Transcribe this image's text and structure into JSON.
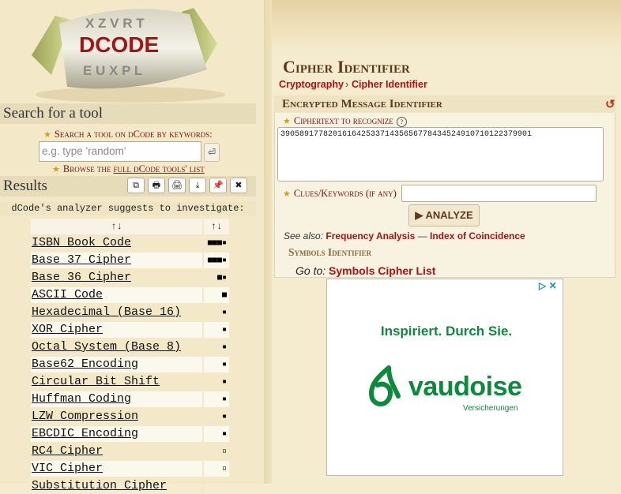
{
  "logo": {
    "letters_top": "X Z V R T",
    "brand": "DCODE",
    "letters_bottom": "E U X P L"
  },
  "search": {
    "heading": "Search for a tool",
    "label": "Search a tool on dCode by keywords:",
    "placeholder": "e.g. type 'random'",
    "enter_icon": "⏎",
    "browse_prefix": "Browse the",
    "browse_link": "full dCode tools' list"
  },
  "results": {
    "heading": "Results",
    "toolbar": [
      "⧉",
      "🖶",
      "🖨",
      "⤓",
      "📌",
      "✖"
    ],
    "toolbar_icons": [
      "copy-icon",
      "screenshot-icon",
      "print-icon",
      "download-icon",
      "pin-icon",
      "close-icon"
    ],
    "suggest": "dCode's analyzer suggests to investigate:",
    "col_name_sort": "↑↓",
    "col_score_sort": "↑↓",
    "rows": [
      {
        "name": "ISBN Book Code",
        "score": "■■■▪"
      },
      {
        "name": "Base 37 Cipher",
        "score": "■■■▪"
      },
      {
        "name": "Base 36 Cipher",
        "score": "■▪"
      },
      {
        "name": "ASCII Code",
        "score": "■"
      },
      {
        "name": "Hexadecimal (Base 16)",
        "score": "▪"
      },
      {
        "name": "XOR Cipher",
        "score": "▪"
      },
      {
        "name": "Octal System (Base 8)",
        "score": "▪"
      },
      {
        "name": "Base62 Encoding",
        "score": "▪"
      },
      {
        "name": "Circular Bit Shift",
        "score": "▪"
      },
      {
        "name": "Huffman Coding",
        "score": "▪"
      },
      {
        "name": "LZW Compression",
        "score": "▪"
      },
      {
        "name": "EBCDIC Encoding",
        "score": "▪"
      },
      {
        "name": "RC4 Cipher",
        "score": "▫"
      },
      {
        "name": "VIC Cipher",
        "score": "▫"
      },
      {
        "name": "Substitution Cipher",
        "score": ""
      }
    ]
  },
  "page": {
    "title": "Cipher Identifier",
    "breadcrumb_1": "Cryptography",
    "breadcrumb_sep": "›",
    "breadcrumb_2": "Cipher Identifier"
  },
  "identifier": {
    "title": "Encrypted Message Identifier",
    "reset_icon": "↺",
    "ciphertext_label": "Ciphertext to recognize",
    "help": "?",
    "ciphertext_value": "3905891778201616425337143565677843452491071012237990​1",
    "clues_label": "Clues/Keywords (if any)",
    "clues_value": "",
    "analyze_label": "▶ ANALYZE"
  },
  "seealso": {
    "label": "See also:",
    "link1": "Frequency Analysis",
    "dash": "—",
    "link2": "Index of Coincidence"
  },
  "symbols": {
    "heading": "Symbols Identifier",
    "goto_label": "Go to:",
    "goto_link": "Symbols Cipher List"
  },
  "ad": {
    "tagline": "Inspiriert. Durch Sie.",
    "brand": "vaudoise",
    "sub": "Versicherungen",
    "close_icons": "▷ ✕"
  }
}
